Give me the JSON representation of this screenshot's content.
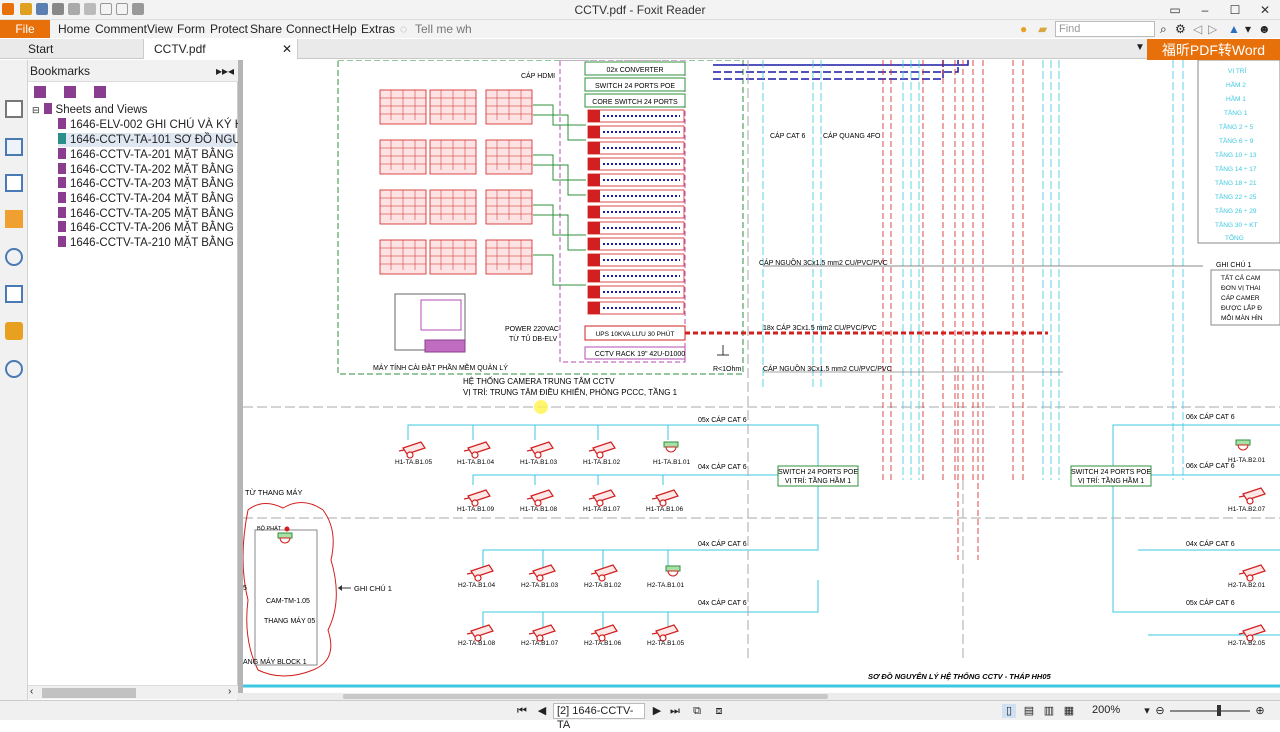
{
  "app": {
    "window_title": "CCTV.pdf - Foxit Reader",
    "brand_banner": "福昕PDF转Word"
  },
  "menu": {
    "file": "File",
    "items": [
      "Home",
      "Comment",
      "View",
      "Form",
      "Protect",
      "Share",
      "Connect",
      "Help",
      "Extras"
    ],
    "tell_me": "Tell me wh",
    "find_placeholder": "Find"
  },
  "tabs": {
    "start": "Start",
    "doc": "CCTV.pdf"
  },
  "bookmarks": {
    "header": "Bookmarks",
    "root": "Sheets and Views",
    "items": [
      "1646-ELV-002 GHI CHÚ VÀ KÝ HIỆU",
      "1646-CCTV-TA-101 SƠ ĐỒ NGUYÊN L",
      "1646-CCTV-TA-201 MẶT BẰNG BỐ TR",
      "1646-CCTV-TA-202 MẶT BẰNG BỐ TR",
      "1646-CCTV-TA-203 MẶT BẰNG BỐ TR",
      "1646-CCTV-TA-204 MẶT BẰNG BỐ TR",
      "1646-CCTV-TA-205 MẶT BẰNG BỐ TR",
      "1646-CCTV-TA-206 MẶT BẰNG BỐ TR",
      "1646-CCTV-TA-210 MẶT BẰNG BỐ TR"
    ],
    "selected_index": 1
  },
  "drawing": {
    "rack_labels": [
      "02x CONVERTER",
      "SWITCH 24 PORTS POE",
      "CORE SWITCH 24 PORTS"
    ],
    "cap_hdmi": "CÁP HDMI",
    "ups": "UPS 10KVA LƯU 30 PHÚT",
    "rack": "CCTV RACK 19\" 42U-D1000",
    "power": "POWER 220VAC",
    "power2": "TỪ TỦ DB-ELV",
    "ground": "R<1Ohm",
    "pc_label": "MÁY TÍNH CÀI ĐẶT PHẦN MỀM QUẢN LÝ",
    "center_title": "HỆ THỐNG CAMERA TRUNG TÂM CCTV",
    "center_loc": "VỊ TRÍ: TRUNG TÂM ĐIỀU KHIỂN, PHÒNG PCCC, TẦNG 1",
    "cap_cat6": "CÁP CAT 6",
    "cap_quang": "CÁP QUANG 4FO",
    "cap_nguon1": "CÁP NGUỒN 3Cx1.5 mm2 CU/PVC/PVC",
    "cap_18x": "18x CÁP 3Cx1.5 mm2 CU/PVC/PVC",
    "cap_nguon2": "CÁP NGUỒN 3Cx1.5 mm2 CU/PVC/PVC",
    "switch_a1": "SWITCH 24 PORTS POE",
    "switch_a2": "VỊ TRÍ: TẦNG HẦM 1",
    "switch_b1": "SWITCH 24 PORTS POE",
    "switch_b2": "VỊ TRÍ: TẦNG HẦM 1",
    "run_05x": "05x CÁP CAT 6",
    "run_04x_a": "04x CÁP CAT 6",
    "run_04x_b": "04x CÁP CAT 6",
    "run_04x_c": "04x CÁP CAT 6",
    "run_06x_a": "06x CÁP CAT 6",
    "run_06x_b": "06x CÁP CAT 6",
    "run_04x_d": "04x CÁP CAT 6",
    "run_05x_b": "05x CÁP CAT 6",
    "elevator_from": "TỪ THANG MÁY",
    "bo_phat": "BỘ PHÁT",
    "cam_tm": "CAM-TM-1.05",
    "thang_may": "THANG MÁY 05",
    "block": "ANG MÁY BLOCK 1",
    "ghi_chu_arrow": "GHI CHÚ 1",
    "left_edge_digit": "5",
    "footer_title": "SƠ ĐỒ NGUYÊN LÝ HỆ THỐNG CCTV - THÁP HH05",
    "legend_title": "GHI CHÚ 1",
    "legend_lines": [
      "TẤT CẢ CAM",
      "ĐƠN VỊ THAI",
      "CÁP CAMER",
      "ĐƯỢC LẮP Đ",
      "MỖI MÀN HÌN"
    ],
    "floor_table": [
      "VỊ TRÍ",
      "HẦM 2",
      "HẦM 1",
      "TẦNG 1",
      "TẦNG 2 ÷ 5",
      "TẦNG 6 ÷ 9",
      "TẦNG 10 ÷ 13",
      "TẦNG 14 ÷ 17",
      "TẦNG 18 ÷ 21",
      "TẦNG 22 ÷ 25",
      "TẦNG 26 ÷ 29",
      "TẦNG 30 ÷ KT",
      "TỔNG"
    ],
    "cam_row1": [
      "H1-TA.B1.05",
      "H1-TA.B1.04",
      "H1-TA.B1.03",
      "H1-TA.B1.02",
      "H1-TA.B1.01"
    ],
    "cam_row2": [
      "H1-TA.B1.09",
      "H1-TA.B1.08",
      "H1-TA.B1.07",
      "H1-TA.B1.06"
    ],
    "cam_row3": [
      "H2-TA.B1.04",
      "H2-TA.B1.03",
      "H2-TA.B1.02",
      "H2-TA.B1.01"
    ],
    "cam_row4": [
      "H2-TA.B1.08",
      "H2-TA.B1.07",
      "H2-TA.B1.06",
      "H2-TA.B1.05"
    ],
    "cam_right": [
      "H1-TA.B2.01",
      "H1-TA.B2.07",
      "H2-TA.B2.01",
      "H2-TA.B2.05"
    ]
  },
  "status": {
    "page": "[2] 1646-CCTV-TA",
    "zoom": "200%"
  },
  "colors": {
    "accent": "#e8700a",
    "drawing_red": "#d21f1f",
    "drawing_cyan": "#3cc8e0",
    "drawing_green": "#2f8f3a",
    "drawing_blue": "#1a1aa8",
    "drawing_magenta": "#b44cb4"
  }
}
